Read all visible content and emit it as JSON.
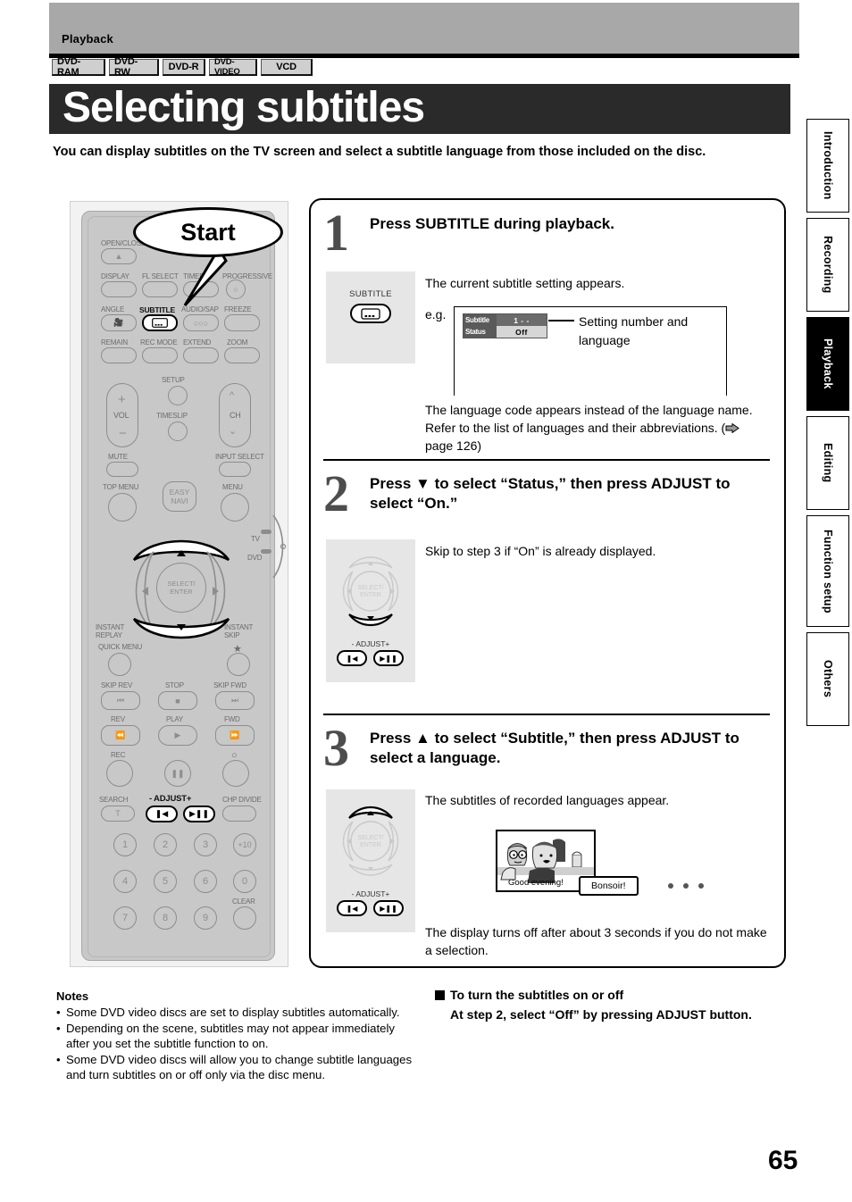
{
  "header": {
    "section_label": "Playback",
    "page_title": "Selecting subtitles",
    "page_number": "65"
  },
  "media_badges": [
    "DVD-RAM",
    "DVD-RW",
    "DVD-R",
    "DVD-VIDEO",
    "VCD"
  ],
  "intro": "You can display subtitles on the TV screen and select a subtitle language from those included on the disc.",
  "side_tabs": [
    {
      "label": "Introduction",
      "active": false
    },
    {
      "label": "Recording",
      "active": false
    },
    {
      "label": "Playback",
      "active": true
    },
    {
      "label": "Editing",
      "active": false
    },
    {
      "label": "Function setup",
      "active": false
    },
    {
      "label": "Others",
      "active": false
    }
  ],
  "remote": {
    "balloon_label": "Start",
    "labels": {
      "open_close": "OPEN/CLOSE",
      "display": "DISPLAY",
      "fl_select": "FL SELECT",
      "timer": "TIMER",
      "progressive": "PROGRESSIVE",
      "angle": "ANGLE",
      "subtitle": "SUBTITLE",
      "audio_sap": "AUDIO/SAP",
      "freeze": "FREEZE",
      "remain": "REMAIN",
      "rec_mode": "REC MODE",
      "extend": "EXTEND",
      "zoom": "ZOOM",
      "setup": "SETUP",
      "vol": "VOL",
      "timeslip": "TIMESLIP",
      "ch": "CH",
      "mute": "MUTE",
      "input_select": "INPUT SELECT",
      "top_menu": "TOP MENU",
      "easy_navi": "EASY\nNAVI",
      "menu": "MENU",
      "tv": "TV",
      "dvd": "DVD",
      "select_enter": "SELECT/\nENTER",
      "instant_replay": "INSTANT\nREPLAY",
      "instant_skip": "INSTANT\nSKIP",
      "quick_menu": "QUICK MENU",
      "skip_rev": "SKIP REV",
      "stop": "STOP",
      "skip_fwd": "SKIP FWD",
      "rev": "REV",
      "play": "PLAY",
      "fwd": "FWD",
      "rec": "REC",
      "search": "SEARCH",
      "adjust": "- ADJUST+",
      "chp_divide": "CHP DIVIDE",
      "clear": "CLEAR"
    },
    "numeric_keys": [
      "1",
      "2",
      "3",
      "+10",
      "4",
      "5",
      "6",
      "0",
      "7",
      "8",
      "9",
      ""
    ],
    "search_key": "T"
  },
  "steps": [
    {
      "number": "1",
      "title": "Press SUBTITLE during playback.",
      "button_label": "SUBTITLE",
      "text_1": "The current subtitle setting appears.",
      "eg_label": "e.g.",
      "osd": {
        "row1_key": "Subtitle",
        "row1_val": "1  - -",
        "row2_key": "Status",
        "row2_val": "Off"
      },
      "callout": "Setting number and\nlanguage",
      "callout_line1": "Setting number and",
      "callout_line2": "language",
      "text_2": "The language code appears instead of the language name. Refer to the list of languages and their abbreviations. (",
      "text_2_tail": " page 126)"
    },
    {
      "number": "2",
      "title": "Press ▼ to select “Status,” then press ADJUST to select “On.”",
      "text_1": "Skip to step 3 if “On” is already displayed.",
      "adjust_label": "- ADJUST+",
      "select_enter": "SELECT/\nENTER"
    },
    {
      "number": "3",
      "title": "Press ▲ to select “Subtitle,” then press ADJUST to select a language.",
      "text_1": "The subtitles of recorded languages appear.",
      "text_2": "The display turns off after about 3 seconds if you do not make a selection.",
      "adjust_label": "- ADJUST+",
      "select_enter": "SELECT/\nENTER",
      "tv_subtitle_en": "Good evening!",
      "tv_subtitle_fr": "Bonsoir!"
    }
  ],
  "notes": {
    "heading": "Notes",
    "items": [
      "Some DVD video discs are set to display subtitles automatically.",
      "Depending on the scene, subtitles may not appear immediately after you set the subtitle function to on.",
      "Some DVD video discs will allow you to change subtitle languages and turn subtitles on or off only via the disc menu."
    ]
  },
  "right_note": {
    "heading": "To turn the subtitles on or off",
    "body": "At step 2, select “Off” by pressing ADJUST button."
  }
}
